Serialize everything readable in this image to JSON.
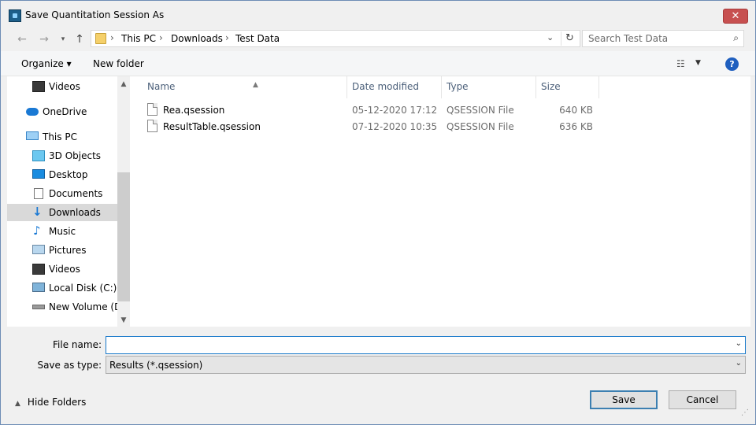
{
  "window": {
    "title": "Save Quantitation Session As",
    "close_label": "✕"
  },
  "address": {
    "crumbs": [
      "This PC",
      "Downloads",
      "Test Data"
    ],
    "separator": "›"
  },
  "search": {
    "placeholder": "Search Test Data"
  },
  "commands": {
    "organize": "Organize ▾",
    "new_folder": "New folder",
    "help": "?"
  },
  "nav": {
    "items": [
      {
        "label": "Videos",
        "icon": "videos-icon"
      },
      {
        "label": "OneDrive",
        "icon": "onedrive-icon"
      },
      {
        "label": "This PC",
        "icon": "this-pc-icon"
      },
      {
        "label": "3D Objects",
        "icon": "3d-objects-icon"
      },
      {
        "label": "Desktop",
        "icon": "desktop-icon"
      },
      {
        "label": "Documents",
        "icon": "documents-icon"
      },
      {
        "label": "Downloads",
        "icon": "downloads-icon",
        "selected": true
      },
      {
        "label": "Music",
        "icon": "music-icon"
      },
      {
        "label": "Pictures",
        "icon": "pictures-icon"
      },
      {
        "label": "Videos",
        "icon": "videos-icon"
      },
      {
        "label": "Local Disk (C:)",
        "icon": "local-disk-icon"
      },
      {
        "label": "New Volume (D:",
        "icon": "drive-icon"
      }
    ]
  },
  "columns": [
    "Name",
    "Date modified",
    "Type",
    "Size"
  ],
  "files": [
    {
      "name": "Rea.qsession",
      "date": "05-12-2020 17:12",
      "type": "QSESSION File",
      "size": "640 KB"
    },
    {
      "name": "ResultTable.qsession",
      "date": "07-12-2020 10:35",
      "type": "QSESSION File",
      "size": "636 KB"
    }
  ],
  "form": {
    "file_name_label": "File name:",
    "file_name_value": "",
    "save_type_label": "Save as type:",
    "save_type_value": "Results (*.qsession)"
  },
  "footer": {
    "hide_folders": "Hide Folders",
    "save": "Save",
    "cancel": "Cancel"
  },
  "colors": {
    "accent": "#1979ca",
    "selected_bg": "#d9d9d9",
    "link": "#1e3287",
    "close": "#c75050"
  }
}
